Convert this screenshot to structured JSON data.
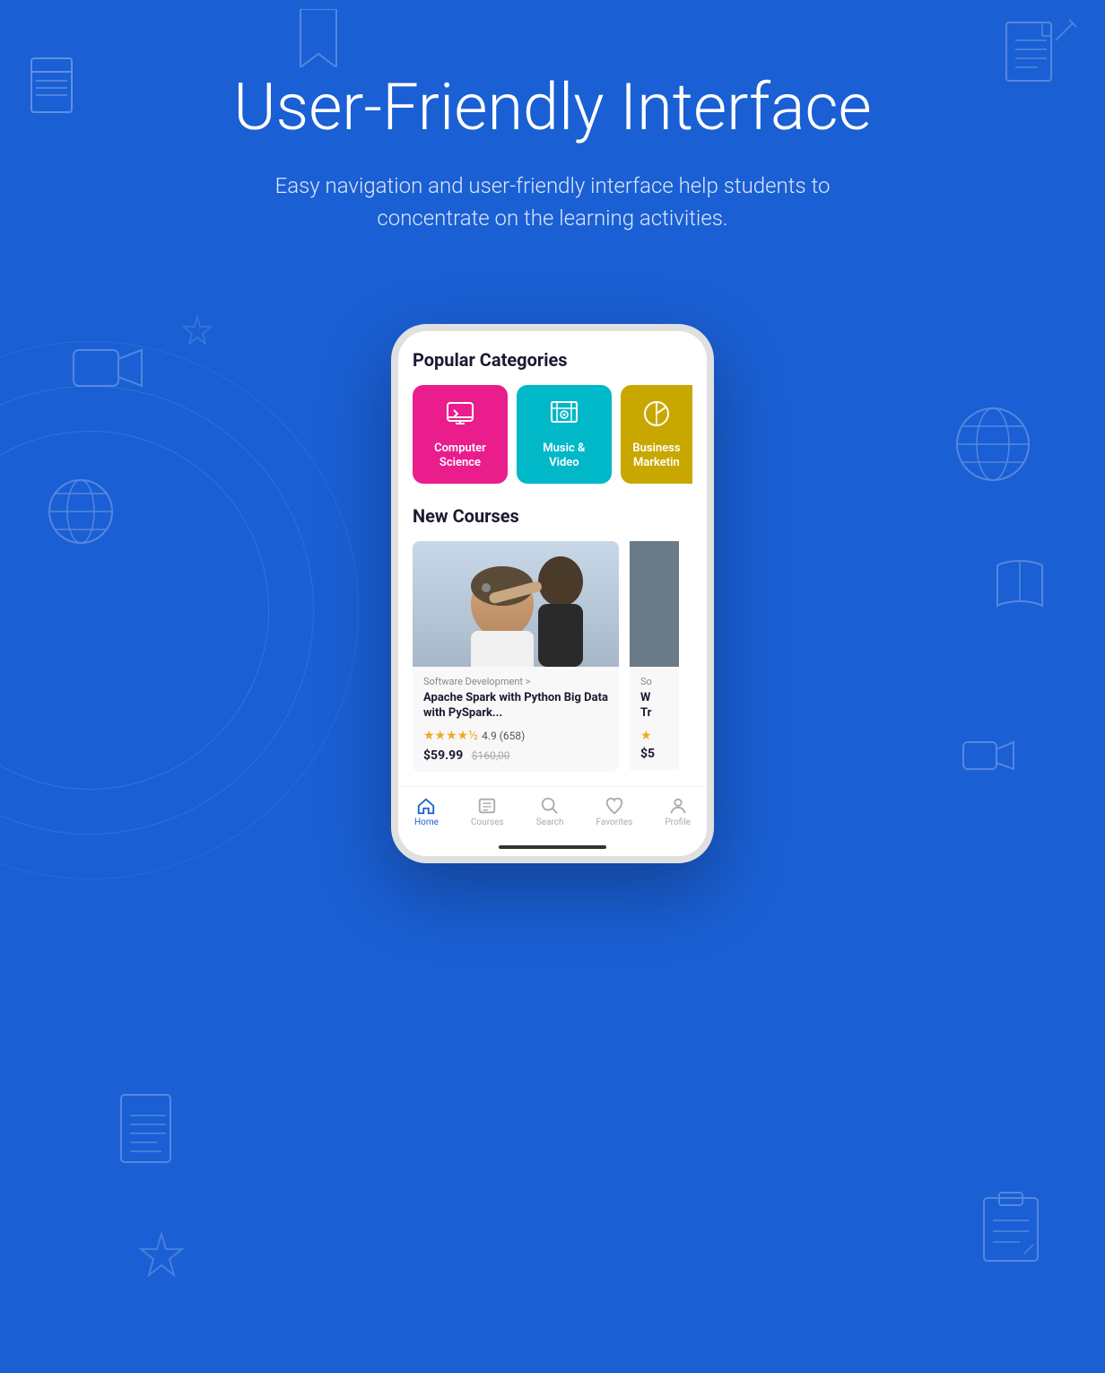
{
  "page": {
    "background_color": "#1a5fd4",
    "title": "User-Friendly Interface",
    "subtitle": "Easy navigation and user-friendly interface help students to concentrate on the learning activities."
  },
  "app": {
    "sections": {
      "popular_categories": {
        "label": "Popular Categories",
        "categories": [
          {
            "id": "computer-science",
            "label": "Computer Science",
            "color": "#e91e8c",
            "icon": "💻"
          },
          {
            "id": "music-video",
            "label": "Music & Video",
            "color": "#00b8c8",
            "icon": "🎵"
          },
          {
            "id": "business-marketing",
            "label": "Business Marketing",
            "color": "#c8a800",
            "icon": "📊"
          }
        ]
      },
      "new_courses": {
        "label": "New Courses",
        "courses": [
          {
            "id": "apache-spark",
            "category": "Software Development >",
            "title": "Apache Spark with Python Big Data with PySpark...",
            "rating": "4.9",
            "reviews": "658",
            "price_current": "$59.99",
            "price_original": "$160,00",
            "stars_filled": 4,
            "stars_half": 1
          },
          {
            "id": "second-course",
            "category": "So",
            "title": "W Tr",
            "price_current": "$5"
          }
        ]
      }
    },
    "nav": {
      "items": [
        {
          "id": "home",
          "label": "Home",
          "icon": "home",
          "active": true
        },
        {
          "id": "courses",
          "label": "Courses",
          "icon": "courses",
          "active": false
        },
        {
          "id": "search",
          "label": "Search",
          "icon": "search",
          "active": false
        },
        {
          "id": "favorites",
          "label": "Favorites",
          "icon": "favorites",
          "active": false
        },
        {
          "id": "profile",
          "label": "Profile",
          "icon": "profile",
          "active": false
        }
      ]
    }
  },
  "icons": {
    "computer_science": "🖥",
    "music_video": "🎵",
    "business": "📊"
  }
}
